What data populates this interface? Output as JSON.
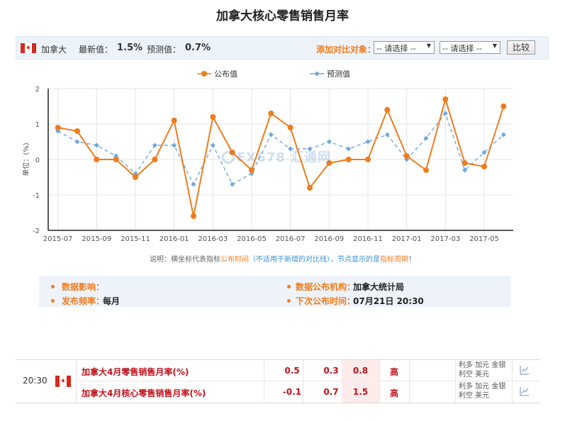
{
  "title": "加拿大核心零售销售月率",
  "info": {
    "country": "加拿大",
    "latest_label": "最新值：",
    "latest_value": "1.5%",
    "forecast_label": "预测值：",
    "forecast_value": "0.7%",
    "compare_label": "添加对比对象：",
    "select1": "-- 请选择 --",
    "select2": "-- 请选择 --",
    "compare_button": "比较"
  },
  "watermark": "FX678 汇通网",
  "chart_data": {
    "type": "line",
    "x": [
      "2015-07",
      "2015-08",
      "2015-09",
      "2015-10",
      "2015-11",
      "2015-12",
      "2016-01",
      "2016-02",
      "2016-03",
      "2016-04",
      "2016-05",
      "2016-06",
      "2016-07",
      "2016-08",
      "2016-09",
      "2016-10",
      "2016-11",
      "2016-12",
      "2017-01",
      "2017-02",
      "2017-03",
      "2017-04",
      "2017-05",
      "2017-06"
    ],
    "series": [
      {
        "name": "公布值",
        "color": "#f07c1c",
        "values": [
          0.9,
          0.8,
          0.0,
          0.0,
          -0.5,
          0.0,
          1.1,
          -1.6,
          1.2,
          0.2,
          -0.3,
          1.3,
          0.9,
          -0.8,
          -0.1,
          0.0,
          0.0,
          1.4,
          0.1,
          -0.3,
          1.7,
          -0.1,
          -0.2,
          1.5
        ]
      },
      {
        "name": "预测值",
        "color": "#6fa8e0",
        "values": [
          0.8,
          0.5,
          0.4,
          0.1,
          -0.4,
          0.4,
          0.4,
          -0.7,
          0.4,
          -0.7,
          -0.4,
          0.7,
          0.3,
          0.3,
          0.5,
          0.3,
          0.5,
          0.7,
          0.0,
          0.6,
          1.3,
          -0.3,
          0.2,
          0.7
        ]
      }
    ],
    "xticks": [
      "2015-07",
      "2015-09",
      "2015-11",
      "2016-01",
      "2016-03",
      "2016-05",
      "2016-07",
      "2016-09",
      "2016-11",
      "2017-01",
      "2017-03",
      "2017-05"
    ],
    "yticks": [
      "-2",
      "-1",
      "0",
      "1",
      "2"
    ],
    "ylabel": "单位：(%)",
    "ylim": [
      -2,
      2
    ],
    "grid": true,
    "legend": "top-center"
  },
  "note": {
    "p1": "说明：横坐标代表指标",
    "p2": "公布时间",
    "p3": "（",
    "p4": "不适用于新增的对比线",
    "p5": "），节点显示的是",
    "p6": "指标周期",
    "p7": "！"
  },
  "details": {
    "impact_label": "数据影响：",
    "impact_value": "",
    "agency_label": "数据公布机构：",
    "agency_value": "加拿大统计局",
    "freq_label": "发布频率：",
    "freq_value": "每月",
    "next_label": "下次公布时间：",
    "next_value": "07月21日 20:30"
  },
  "events": {
    "time": "20:30",
    "rows": [
      {
        "name": "加拿大4月零售销售月率(%)",
        "previous": "0.5",
        "forecast": "0.3",
        "actual": "0.8",
        "importance": "高",
        "effect_line1": "利多  加元 金银",
        "effect_line2": "利空  美元"
      },
      {
        "name": "加拿大4月核心零售销售月率(%)",
        "previous": "-0.1",
        "forecast": "0.7",
        "actual": "1.5",
        "importance": "高",
        "effect_line1": "利多  加元 金银",
        "effect_line2": "利空  美元"
      }
    ]
  }
}
